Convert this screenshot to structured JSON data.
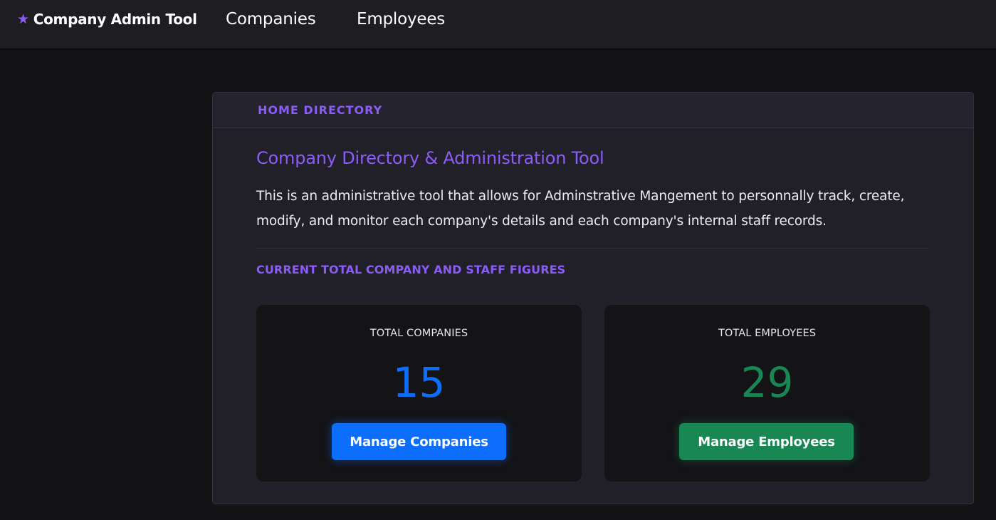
{
  "navbar": {
    "brand_icon": "star-icon",
    "brand_label": "Company Admin Tool",
    "links": [
      "Companies",
      "Employees"
    ]
  },
  "card": {
    "header": "HOME DIRECTORY",
    "title": "Company Directory & Administration Tool",
    "description": "This is an administrative tool that allows for Adminstrative Mangement to personnally track, create, modify, and monitor each company's details and each company's internal staff records.",
    "section_label": "CURRENT TOTAL COMPANY AND STAFF FIGURES"
  },
  "stats": {
    "companies": {
      "label": "TOTAL COMPANIES",
      "value": "15",
      "button": "Manage Companies",
      "color": "#0d6efd"
    },
    "employees": {
      "label": "TOTAL EMPLOYEES",
      "value": "29",
      "button": "Manage Employees",
      "color": "#198754"
    }
  },
  "colors": {
    "accent": "#8b5cf6",
    "background": "#131316",
    "navbar": "#1e1e22",
    "card": "#212029"
  }
}
